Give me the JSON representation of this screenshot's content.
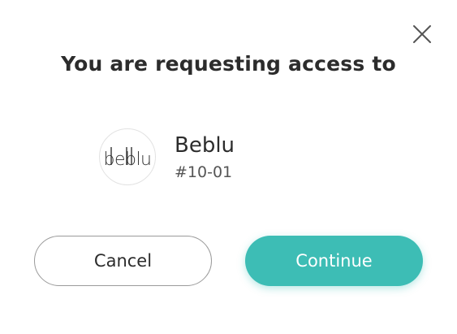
{
  "dialog": {
    "title": "You are requesting access to",
    "close_icon": "close-icon"
  },
  "venue": {
    "logo_text": "beblu",
    "name": "Beblu",
    "code": "#10-01"
  },
  "actions": {
    "cancel_label": "Cancel",
    "continue_label": "Continue"
  },
  "colors": {
    "accent": "#3dbdb5",
    "text_primary": "#2c2c2c",
    "text_secondary": "#555555",
    "cancel_border": "#9a9a9a"
  }
}
